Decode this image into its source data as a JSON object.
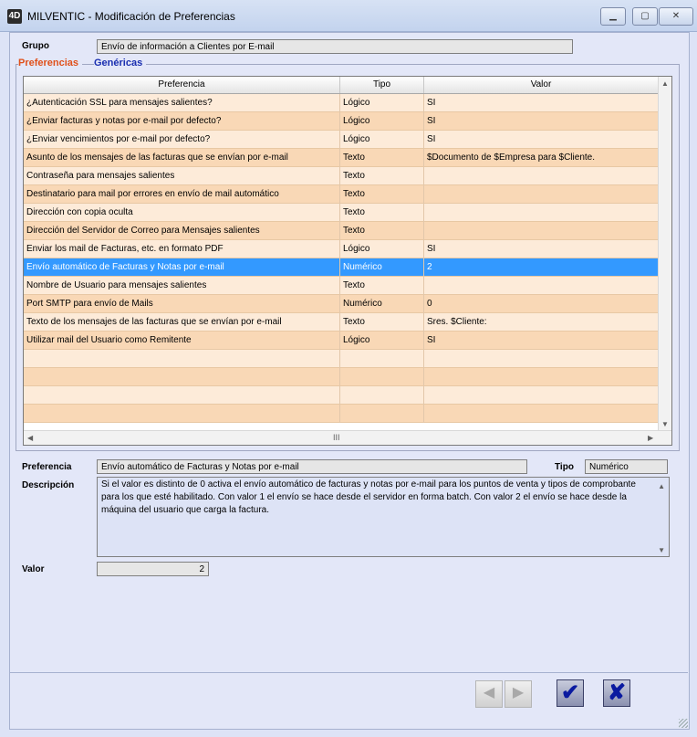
{
  "window": {
    "title": "MILVENTIC - Modificación de Preferencias",
    "app_icon": "4D",
    "minimize": "▁",
    "maximize": "▢",
    "close": "✕"
  },
  "grupo": {
    "label": "Grupo",
    "value": "Envío de información a Clientes por E-mail"
  },
  "tabs": {
    "preferencias": "Preferencias",
    "genericas": "Genéricas"
  },
  "grid": {
    "headers": [
      "Preferencia",
      "Tipo",
      "Valor"
    ],
    "rows": [
      [
        "¿Autenticación SSL para mensajes salientes?",
        "Lógico",
        "SI"
      ],
      [
        "¿Enviar facturas y notas por e-mail por defecto?",
        "Lógico",
        "SI"
      ],
      [
        "¿Enviar vencimientos por e-mail por defecto?",
        "Lógico",
        "SI"
      ],
      [
        "Asunto de los mensajes de las facturas que se envían por e-mail",
        "Texto",
        "$Documento de $Empresa para $Cliente."
      ],
      [
        "Contraseña para mensajes salientes",
        "Texto",
        ""
      ],
      [
        "Destinatario para mail por errores en envío de mail automático",
        "Texto",
        ""
      ],
      [
        "Dirección con copia oculta",
        "Texto",
        ""
      ],
      [
        "Dirección del Servidor de Correo para Mensajes salientes",
        "Texto",
        ""
      ],
      [
        "Enviar los mail de Facturas, etc. en formato PDF",
        "Lógico",
        "SI"
      ],
      [
        "Envío automático de Facturas y Notas por e-mail",
        "Numérico",
        "2"
      ],
      [
        "Nombre de Usuario para mensajes salientes",
        "Texto",
        ""
      ],
      [
        "Port SMTP para envío de Mails",
        "Numérico",
        "0"
      ],
      [
        "Texto de los mensajes de las facturas que se envían por e-mail",
        "Texto",
        "Sres. $Cliente:"
      ],
      [
        "Utilizar mail del Usuario como Remitente",
        "Lógico",
        "SI"
      ],
      [
        "",
        "",
        ""
      ],
      [
        "",
        "",
        ""
      ],
      [
        "",
        "",
        ""
      ],
      [
        "",
        "",
        ""
      ]
    ],
    "selected_index": 9,
    "scroll_left": "◀",
    "scroll_right": "▶",
    "scroll_up": "▲",
    "scroll_down": "▼",
    "scroll_grip": "III"
  },
  "detail": {
    "preferencia_label": "Preferencia",
    "preferencia_value": "Envío automático de Facturas y Notas por e-mail",
    "tipo_label": "Tipo",
    "tipo_value": "Numérico",
    "descripcion_label": "Descripción",
    "descripcion_value": "Si el valor es distinto de 0 activa el envío automático de facturas y notas por e-mail para los puntos de venta y tipos de comprobante para los que esté habilitado. Con valor 1 el envío se hace desde el servidor en forma batch. Con valor 2 el envío se hace desde la máquina del usuario que carga la factura.",
    "valor_label": "Valor",
    "valor_value": "2"
  },
  "buttons": {
    "prev": "◀",
    "next": "▶",
    "ok": "✔",
    "cancel": "✘"
  },
  "colors": {
    "row_light": "#fdebd9",
    "row_dark": "#f9d8b6",
    "row_selected": "#3399ff",
    "tab_active": "#e0501a",
    "tab_inactive": "#1a2fb0"
  }
}
